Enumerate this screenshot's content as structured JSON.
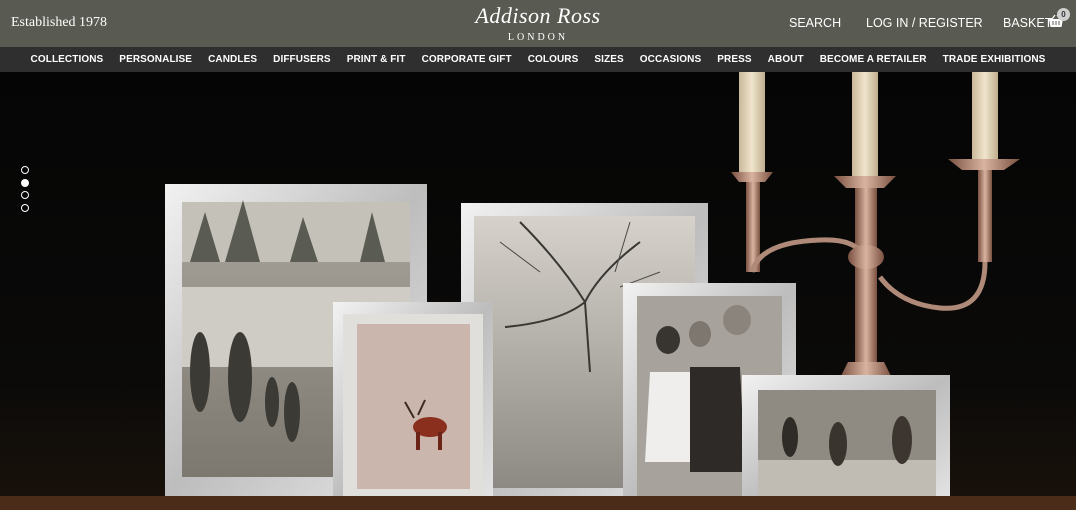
{
  "header": {
    "established": "Established 1978",
    "logo_main": "Addison Ross",
    "logo_sub": "LONDON",
    "search": "SEARCH",
    "login": "LOG IN / REGISTER",
    "basket": "BASKET",
    "basket_count": "0"
  },
  "nav": {
    "items": [
      {
        "label": "COLLECTIONS"
      },
      {
        "label": "PERSONALISE"
      },
      {
        "label": "CANDLES"
      },
      {
        "label": "DIFFUSERS"
      },
      {
        "label": "PRINT & FIT"
      },
      {
        "label": "CORPORATE GIFT"
      },
      {
        "label": "COLOURS"
      },
      {
        "label": "SIZES"
      },
      {
        "label": "OCCASIONS"
      },
      {
        "label": "PRESS"
      },
      {
        "label": "ABOUT"
      },
      {
        "label": "BECOME A RETAILER"
      },
      {
        "label": "TRADE EXHIBITIONS"
      }
    ]
  },
  "slider": {
    "slide_count": 4,
    "active_index": 1
  },
  "colors": {
    "topbar": "#595a51",
    "navbar": "#2f2f2f",
    "silver": "#d8d8d8"
  }
}
